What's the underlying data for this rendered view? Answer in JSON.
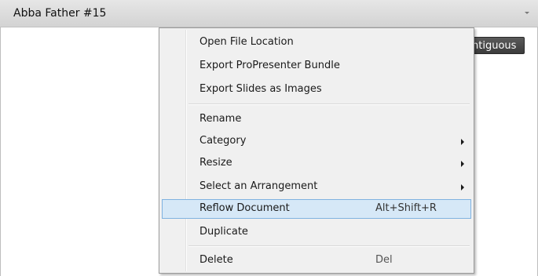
{
  "header": {
    "document_title": "Abba Father #15"
  },
  "toolbar": {
    "button_label": "Contiguous"
  },
  "context_menu": {
    "items": [
      {
        "label": "Open File Location",
        "shortcut": "",
        "has_submenu": false
      },
      {
        "label": "Export ProPresenter Bundle",
        "shortcut": "",
        "has_submenu": false
      },
      {
        "label": "Export Slides as Images",
        "shortcut": "",
        "has_submenu": false
      },
      {
        "label": "Rename",
        "shortcut": "",
        "has_submenu": false
      },
      {
        "label": "Category",
        "shortcut": "",
        "has_submenu": true
      },
      {
        "label": "Resize",
        "shortcut": "",
        "has_submenu": true
      },
      {
        "label": "Select an Arrangement",
        "shortcut": "",
        "has_submenu": true
      },
      {
        "label": "Reflow Document",
        "shortcut": "Alt+Shift+R",
        "has_submenu": false,
        "highlighted": true
      },
      {
        "label": "Duplicate",
        "shortcut": "",
        "has_submenu": false
      },
      {
        "label": "Delete",
        "shortcut": "Del",
        "has_submenu": false
      }
    ]
  },
  "colors": {
    "highlight_fill": "#d6e8f7",
    "highlight_border": "#7fb2e0",
    "menu_background": "#f0f0f0",
    "toolbar_button": "#4a4a4a"
  }
}
